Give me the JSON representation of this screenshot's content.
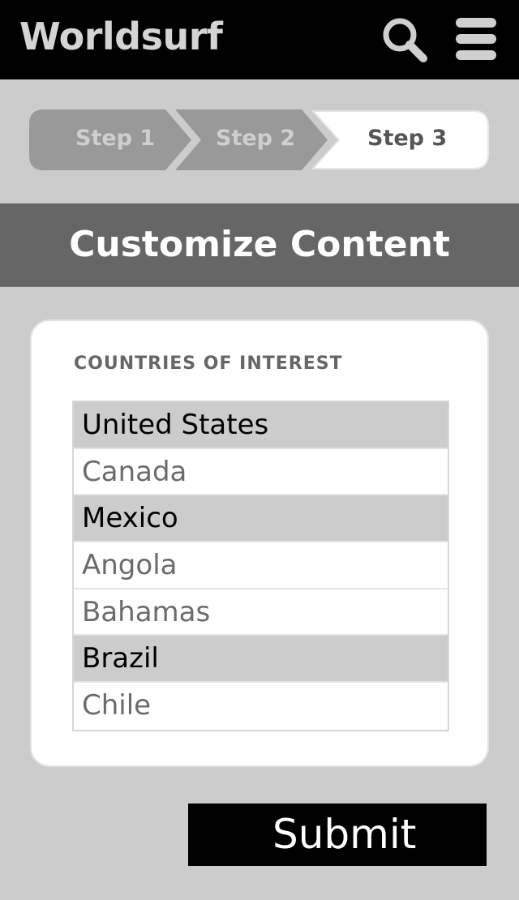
{
  "header": {
    "app_title": "Worldsurf",
    "search_icon": "search-icon",
    "menu_icon": "hamburger-menu-icon",
    "bg_color": "#000000"
  },
  "steps": [
    {
      "label": "Step 1",
      "state": "completed"
    },
    {
      "label": "Step 2",
      "state": "completed"
    },
    {
      "label": "Step 3",
      "state": "current"
    }
  ],
  "section": {
    "title": "Customize Content",
    "bg_color": "#666666"
  },
  "form": {
    "field_label": "COUNTRIES OF INTEREST",
    "countries": [
      {
        "label": "United States",
        "selected": true
      },
      {
        "label": "Canada",
        "selected": false
      },
      {
        "label": "Mexico",
        "selected": true
      },
      {
        "label": "Angola",
        "selected": false
      },
      {
        "label": "Bahamas",
        "selected": false
      },
      {
        "label": "Brazil",
        "selected": true
      },
      {
        "label": "Chile",
        "selected": false
      }
    ]
  },
  "submit_label": "Submit",
  "colors": {
    "page_bg": "#cccccc",
    "selected_row": "#cccccc",
    "step_done": "#999999",
    "step_current": "#ffffff"
  }
}
